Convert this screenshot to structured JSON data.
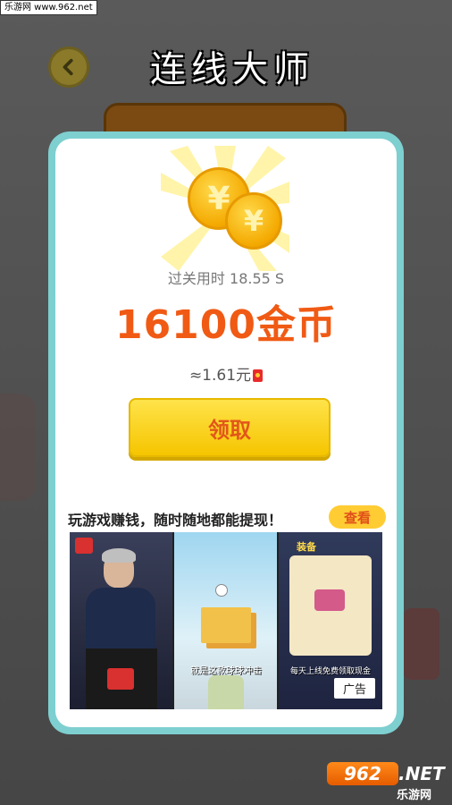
{
  "watermark": "乐游网 www.962.net",
  "game_title": "连线大师",
  "back_button_icon": "back-arrow-icon",
  "reward_card": {
    "clear_time": "过关用时 18.55 S",
    "reward_amount": "16100金币",
    "approx_value": "≈1.61元",
    "claim_label": "领取"
  },
  "promo": {
    "text": "玩游戏赚钱，随时随地都能提现！",
    "view_label": "查看"
  },
  "ad": {
    "badge": "广告",
    "subtitle_1": "就是这款球球冲击",
    "subtitle_3": "每天上线免费领取现金",
    "panel3_title": "装备"
  },
  "site_logo": {
    "number": "962",
    "net": ".NET",
    "name": "乐游网"
  },
  "colors": {
    "accent_orange": "#f05a14",
    "button_yellow": "#ffe34a",
    "card_border": "#7ecfd0"
  }
}
